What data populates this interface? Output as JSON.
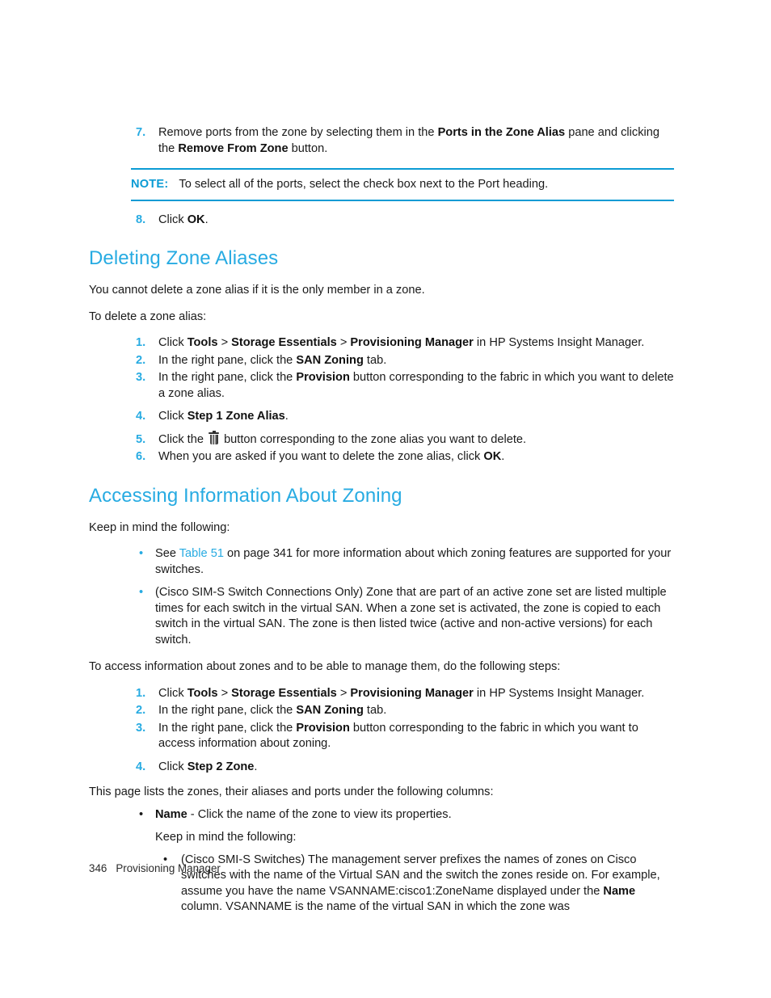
{
  "page": {
    "footer_page_number": "346",
    "footer_title": "Provisioning Manager"
  },
  "colors": {
    "heading_cyan": "#27ABE2",
    "rule_cyan": "#0B9BD4",
    "body_text": "#1a1a1a"
  },
  "top_steps": {
    "items": [
      {
        "num": "7.",
        "segments": [
          {
            "text": "Remove ports from the zone by selecting them in the ",
            "bold": false
          },
          {
            "text": "Ports in the Zone Alias",
            "bold": true
          },
          {
            "text": " pane and clicking the ",
            "bold": false
          },
          {
            "text": "Remove From Zone",
            "bold": true
          },
          {
            "text": " button.",
            "bold": false
          }
        ]
      }
    ],
    "step8": {
      "num": "8.",
      "prefix": "Click ",
      "bold": "OK",
      "suffix": "."
    }
  },
  "note": {
    "label": "NOTE:",
    "text": "To select all of the ports, select the check box next to the Port heading."
  },
  "section_deleting": {
    "heading": "Deleting Zone Aliases",
    "intro1": "You cannot delete a zone alias if it is the only member in a zone.",
    "intro2": "To delete a zone alias:",
    "steps": [
      {
        "num": "1.",
        "segments": [
          {
            "text": "Click ",
            "bold": false
          },
          {
            "text": "Tools",
            "bold": true
          },
          {
            "text": " > ",
            "bold": false
          },
          {
            "text": "Storage Essentials",
            "bold": true
          },
          {
            "text": " > ",
            "bold": false
          },
          {
            "text": "Provisioning Manager",
            "bold": true
          },
          {
            "text": " in HP Systems Insight Manager.",
            "bold": false
          }
        ]
      },
      {
        "num": "2.",
        "segments": [
          {
            "text": "In the right pane, click the ",
            "bold": false
          },
          {
            "text": "SAN Zoning",
            "bold": true
          },
          {
            "text": " tab.",
            "bold": false
          }
        ]
      },
      {
        "num": "3.",
        "segments": [
          {
            "text": "In the right pane, click the ",
            "bold": false
          },
          {
            "text": "Provision",
            "bold": true
          },
          {
            "text": " button corresponding to the fabric in which you want to delete a zone alias.",
            "bold": false
          }
        ]
      },
      {
        "num": "4.",
        "segments": [
          {
            "text": "Click ",
            "bold": false
          },
          {
            "text": "Step 1 Zone Alias",
            "bold": true
          },
          {
            "text": ".",
            "bold": false
          }
        ]
      },
      {
        "num": "5.",
        "icon": "trash-icon",
        "segments_before_icon": [
          {
            "text": "Click the ",
            "bold": false
          }
        ],
        "segments_after_icon": [
          {
            "text": " button corresponding to the zone alias you want to delete.",
            "bold": false
          }
        ]
      },
      {
        "num": "6.",
        "segments": [
          {
            "text": "When you are asked if you want to delete the zone alias, click ",
            "bold": false
          },
          {
            "text": "OK",
            "bold": true
          },
          {
            "text": ".",
            "bold": false
          }
        ]
      }
    ]
  },
  "section_accessing": {
    "heading": "Accessing Information About Zoning",
    "intro": "Keep in mind the following:",
    "bullets": [
      {
        "segments": [
          {
            "text": "See ",
            "kind": "plain"
          },
          {
            "text": "Table 51",
            "kind": "xref"
          },
          {
            "text": " on page 341 for more information about which zoning features are supported for your switches.",
            "kind": "plain"
          }
        ]
      },
      {
        "segments": [
          {
            "text": "(Cisco SIM-S Switch Connections Only) Zone that are part of an active zone set are listed multiple times for each switch in the virtual SAN. When a zone set is activated, the zone is copied to each switch in the virtual SAN. The zone is then listed twice (active and non-active versions) for each switch.",
            "kind": "plain"
          }
        ]
      }
    ],
    "lead_in": " To access information about zones and to be able to manage them, do the following steps:",
    "steps": [
      {
        "num": "1.",
        "segments": [
          {
            "text": "Click ",
            "bold": false
          },
          {
            "text": "Tools",
            "bold": true
          },
          {
            "text": " > ",
            "bold": false
          },
          {
            "text": "Storage Essentials",
            "bold": true
          },
          {
            "text": " > ",
            "bold": false
          },
          {
            "text": "Provisioning Manager",
            "bold": true
          },
          {
            "text": " in HP Systems Insight Manager.",
            "bold": false
          }
        ]
      },
      {
        "num": "2.",
        "segments": [
          {
            "text": "In the right pane, click the ",
            "bold": false
          },
          {
            "text": "SAN Zoning",
            "bold": true
          },
          {
            "text": " tab.",
            "bold": false
          }
        ]
      },
      {
        "num": "3.",
        "segments": [
          {
            "text": "In the right pane, click the ",
            "bold": false
          },
          {
            "text": "Provision",
            "bold": true
          },
          {
            "text": " button corresponding to the fabric in which you want to access information about zoning.",
            "bold": false
          }
        ]
      },
      {
        "num": "4.",
        "segments": [
          {
            "text": "Click ",
            "bold": false
          },
          {
            "text": "Step 2 Zone",
            "bold": true
          },
          {
            "text": ".",
            "bold": false
          }
        ]
      }
    ],
    "columns_intro": "This page lists the zones, their aliases and ports under the following columns:",
    "name_bullet": [
      {
        "text": "Name",
        "bold": true
      },
      {
        "text": " - Click the name of the zone to view its properties.",
        "bold": false
      }
    ],
    "keep_in_mind": "Keep in mind the following:",
    "nested_bullets": [
      {
        "segments": [
          {
            "text": "(Cisco SMI-S Switches) The management server prefixes the names of zones on Cisco switches with the name of the Virtual SAN and the switch the zones reside on. For example, assume you have the name VSANNAME:cisco1:ZoneName displayed under the ",
            "bold": false
          },
          {
            "text": "Name",
            "bold": true
          },
          {
            "text": " column. VSANNAME is the name of the virtual SAN in which the zone was",
            "bold": false
          }
        ]
      }
    ]
  }
}
